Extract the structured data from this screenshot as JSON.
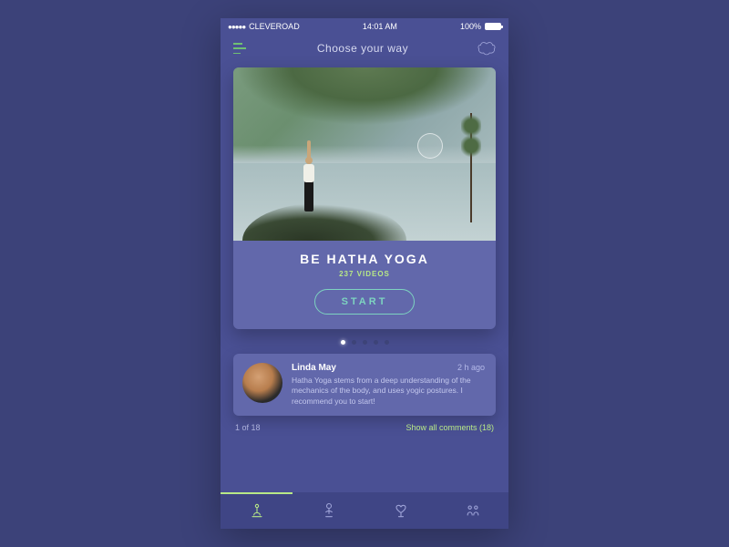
{
  "status": {
    "carrier": "CLEVEROAD",
    "time": "14:01 AM",
    "battery": "100%"
  },
  "header": {
    "title": "Choose your way"
  },
  "card": {
    "title": "BE HATHA YOGA",
    "video_count": "237 VIDEOS",
    "start_label": "START"
  },
  "pagination": {
    "count": 5,
    "active": 0
  },
  "comment": {
    "author": "Linda May",
    "time": "2 h ago",
    "text": "Hatha Yoga stems from a deep understanding of the mechanics of the body, and uses yogic postures. I recommend you to start!"
  },
  "comments_footer": {
    "position": "1 of 18",
    "show_all": "Show all comments (18)"
  }
}
